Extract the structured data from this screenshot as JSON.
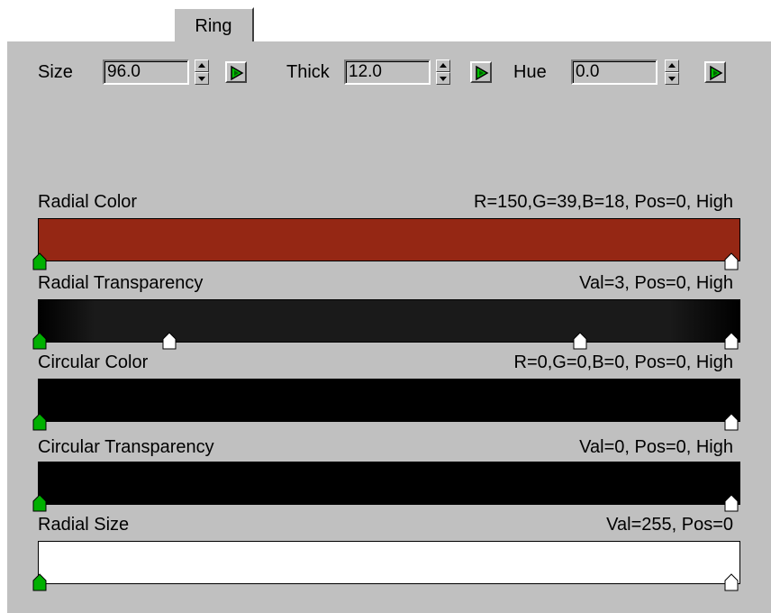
{
  "tab": {
    "label": "Ring"
  },
  "params": {
    "size": {
      "label": "Size",
      "value": "96.0"
    },
    "thick": {
      "label": "Thick",
      "value": "12.0"
    },
    "hue": {
      "label": "Hue",
      "value": "0.0"
    }
  },
  "gradients": [
    {
      "label": "Radial Color",
      "info": "R=150,G=39,B=18, Pos=0, High",
      "color": "#952714"
    },
    {
      "label": "Radial Transparency",
      "info": "Val=3, Pos=0, High"
    },
    {
      "label": "Circular Color",
      "info": "R=0,G=0,B=0, Pos=0, High",
      "color": "#000000"
    },
    {
      "label": "Circular Transparency",
      "info": "Val=0, Pos=0, High",
      "color": "#000000"
    },
    {
      "label": "Radial Size",
      "info": "Val=255, Pos=0",
      "color": "#ffffff"
    }
  ],
  "colors": {
    "panel": "#c0c0c0",
    "flag_active": "#00b000",
    "flag_inactive": "#ffffff",
    "key_icon": "#00c000"
  }
}
